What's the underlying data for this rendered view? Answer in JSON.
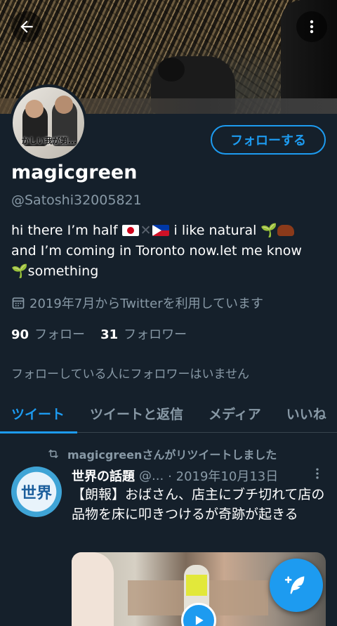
{
  "header": {
    "back_icon": "back-arrow-icon",
    "more_icon": "more-vertical-icon"
  },
  "profile": {
    "avatar_caption": "かしい我が第...",
    "follow_label": "フォローする",
    "name": "magicgreen",
    "handle": "@Satoshi32005821",
    "bio_part1": "hi there I’m half",
    "bio_part2": "i like natural",
    "bio_part3": "and I’m coming in Toronto now.let me know",
    "bio_part4": "something",
    "joined": "2019年7月からTwitterを利用しています",
    "following_count": "90",
    "following_label": "フォロー",
    "followers_count": "31",
    "followers_label": "フォロワー",
    "no_followers_note": "フォローしている人にフォロワーはいません"
  },
  "tabs": [
    {
      "label": "ツイート",
      "active": true
    },
    {
      "label": "ツイートと返信",
      "active": false
    },
    {
      "label": "メディア",
      "active": false
    },
    {
      "label": "いいね",
      "active": false
    }
  ],
  "tweet": {
    "retweet_note": "magicgreenさんがリツイートしました",
    "avatar_text": "世界",
    "author": "世界の話題",
    "handle": "@...",
    "date": "· 2019年10月13日",
    "text": "【朗報】おばさん、店主にブチ切れて店の品物を床に叩きつけるが奇跡が起きる"
  },
  "colors": {
    "background": "#15202b",
    "accent": "#1d9bf0",
    "secondary_text": "#8899a6"
  }
}
